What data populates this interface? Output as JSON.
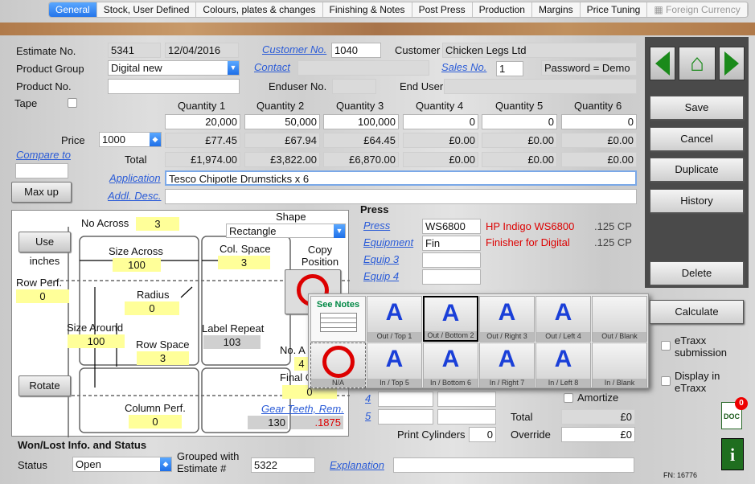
{
  "tabs": [
    "General",
    "Stock, User Defined",
    "Colours, plates & changes",
    "Finishing & Notes",
    "Post Press",
    "Production",
    "Margins",
    "Price Tuning",
    "Foreign Currency"
  ],
  "estimate": {
    "label": "Estimate No.",
    "number": "5341",
    "date": "12/04/2016"
  },
  "customer": {
    "no_label": "Customer No.",
    "no": "1040",
    "label": "Customer",
    "name": "Chicken Legs Ltd"
  },
  "product_group": {
    "label": "Product Group",
    "value": "Digital new"
  },
  "contact": {
    "label": "Contact",
    "value": ""
  },
  "sales": {
    "label": "Sales No.",
    "value": "1",
    "password": "Password = Demo"
  },
  "product_no": {
    "label": "Product No.",
    "value": ""
  },
  "enduser": {
    "no_label": "Enduser No.",
    "name_label": "End User"
  },
  "tape": {
    "label": "Tape"
  },
  "quantities": {
    "labels": [
      "Quantity 1",
      "Quantity 2",
      "Quantity 3",
      "Quantity 4",
      "Quantity 5",
      "Quantity 6"
    ],
    "values": [
      "20,000",
      "50,000",
      "100,000",
      "0",
      "0",
      "0"
    ],
    "prices": [
      "£77.45",
      "£67.94",
      "£64.45",
      "£0.00",
      "£0.00",
      "£0.00"
    ],
    "totals": [
      "£1,974.00",
      "£3,822.00",
      "£6,870.00",
      "£0.00",
      "£0.00",
      "£0.00"
    ]
  },
  "price": {
    "label": "Price",
    "per": "1000",
    "total_label": "Total"
  },
  "compare": {
    "label": "Compare to"
  },
  "application": {
    "label": "Application",
    "value": "Tesco Chipotle Drumsticks x 6"
  },
  "addl": {
    "label": "Addl. Desc."
  },
  "max_up": "Max up",
  "layout": {
    "no_across_label": "No Across",
    "no_across": "3",
    "shape_label": "Shape",
    "shape": "Rectangle",
    "use_inches": "Use inches",
    "size_across_label": "Size Across",
    "size_across": "100",
    "col_space_label": "Col. Space",
    "col_space": "3",
    "copy_pos_label": "Copy Position",
    "row_perf_label": "Row Perf.",
    "row_perf": "0",
    "radius_label": "Radius",
    "radius": "0",
    "size_around_label": "Size Around",
    "size_around": "100",
    "label_repeat_label": "Label Repeat",
    "label_repeat": "103",
    "row_space_label": "Row Space",
    "row_space": "3",
    "no_a_label": "No. A",
    "no_a": "4",
    "final_label": "Final C",
    "final": "0",
    "rotate": "Rotate",
    "col_perf_label": "Column Perf.",
    "col_perf": "0",
    "gear_label": "Gear Teeth, Rem.",
    "gear": "130",
    "gear_rem": ".1875"
  },
  "press": {
    "title": "Press",
    "rows": [
      {
        "label": "Press",
        "value": "WS6800",
        "desc": "HP Indigo WS6800",
        "cp": ".125 CP"
      },
      {
        "label": "Equipment",
        "value": "Fin",
        "desc": "Finisher for Digital",
        "cp": ".125 CP"
      },
      {
        "label": "Equip 3",
        "value": "",
        "desc": "",
        "cp": ""
      },
      {
        "label": "Equip 4",
        "value": "",
        "desc": "",
        "cp": ""
      }
    ],
    "extra": [
      "4",
      "5"
    ],
    "print_cyl_label": "Print Cylinders",
    "print_cyl": "0",
    "amortize": "Amortize",
    "total_label": "Total",
    "total": "£0",
    "override_label": "Override",
    "override": "£0"
  },
  "popup": {
    "see_notes": "See Notes",
    "na": "N/A",
    "top_row": [
      "Out / Top 1",
      "Out / Bottom 2",
      "Out / Right 3",
      "Out / Left 4",
      "Out / Blank"
    ],
    "bottom_row": [
      "In / Top 5",
      "In / Bottom 6",
      "In / Right 7",
      "In / Left 8",
      "In / Blank"
    ],
    "letter": "A"
  },
  "right": {
    "save": "Save",
    "cancel": "Cancel",
    "duplicate": "Duplicate",
    "history": "History",
    "delete": "Delete",
    "calculate": "Calculate",
    "etraxx": "eTraxx submission",
    "display_etraxx": "Display in eTraxx",
    "doc_badge": "0",
    "doc": "DOC",
    "fn": "FN: 16776"
  },
  "status": {
    "section": "Won/Lost Info. and Status",
    "label": "Status",
    "value": "Open",
    "grouped_label": "Grouped with",
    "grouped_label2": "Estimate #",
    "grouped": "5322",
    "explanation": "Explanation"
  }
}
